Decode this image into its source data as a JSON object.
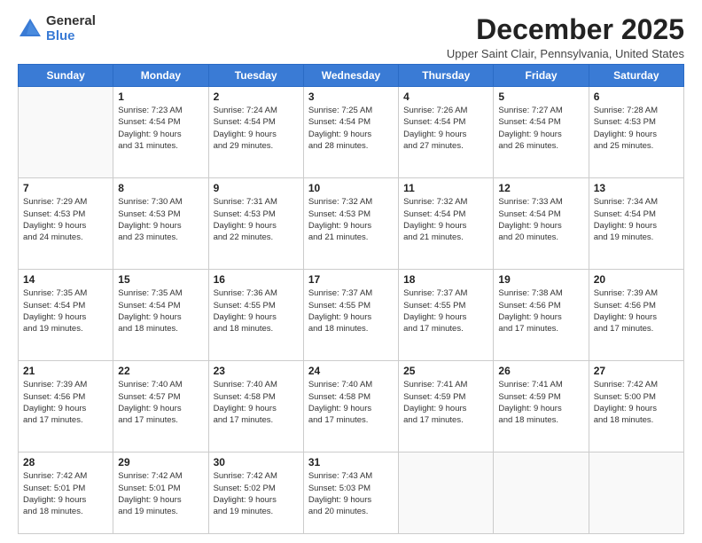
{
  "logo": {
    "general": "General",
    "blue": "Blue"
  },
  "title": "December 2025",
  "location": "Upper Saint Clair, Pennsylvania, United States",
  "days_header": [
    "Sunday",
    "Monday",
    "Tuesday",
    "Wednesday",
    "Thursday",
    "Friday",
    "Saturday"
  ],
  "weeks": [
    [
      {
        "day": "",
        "info": ""
      },
      {
        "day": "1",
        "info": "Sunrise: 7:23 AM\nSunset: 4:54 PM\nDaylight: 9 hours\nand 31 minutes."
      },
      {
        "day": "2",
        "info": "Sunrise: 7:24 AM\nSunset: 4:54 PM\nDaylight: 9 hours\nand 29 minutes."
      },
      {
        "day": "3",
        "info": "Sunrise: 7:25 AM\nSunset: 4:54 PM\nDaylight: 9 hours\nand 28 minutes."
      },
      {
        "day": "4",
        "info": "Sunrise: 7:26 AM\nSunset: 4:54 PM\nDaylight: 9 hours\nand 27 minutes."
      },
      {
        "day": "5",
        "info": "Sunrise: 7:27 AM\nSunset: 4:54 PM\nDaylight: 9 hours\nand 26 minutes."
      },
      {
        "day": "6",
        "info": "Sunrise: 7:28 AM\nSunset: 4:53 PM\nDaylight: 9 hours\nand 25 minutes."
      }
    ],
    [
      {
        "day": "7",
        "info": "Sunrise: 7:29 AM\nSunset: 4:53 PM\nDaylight: 9 hours\nand 24 minutes."
      },
      {
        "day": "8",
        "info": "Sunrise: 7:30 AM\nSunset: 4:53 PM\nDaylight: 9 hours\nand 23 minutes."
      },
      {
        "day": "9",
        "info": "Sunrise: 7:31 AM\nSunset: 4:53 PM\nDaylight: 9 hours\nand 22 minutes."
      },
      {
        "day": "10",
        "info": "Sunrise: 7:32 AM\nSunset: 4:53 PM\nDaylight: 9 hours\nand 21 minutes."
      },
      {
        "day": "11",
        "info": "Sunrise: 7:32 AM\nSunset: 4:54 PM\nDaylight: 9 hours\nand 21 minutes."
      },
      {
        "day": "12",
        "info": "Sunrise: 7:33 AM\nSunset: 4:54 PM\nDaylight: 9 hours\nand 20 minutes."
      },
      {
        "day": "13",
        "info": "Sunrise: 7:34 AM\nSunset: 4:54 PM\nDaylight: 9 hours\nand 19 minutes."
      }
    ],
    [
      {
        "day": "14",
        "info": "Sunrise: 7:35 AM\nSunset: 4:54 PM\nDaylight: 9 hours\nand 19 minutes."
      },
      {
        "day": "15",
        "info": "Sunrise: 7:35 AM\nSunset: 4:54 PM\nDaylight: 9 hours\nand 18 minutes."
      },
      {
        "day": "16",
        "info": "Sunrise: 7:36 AM\nSunset: 4:55 PM\nDaylight: 9 hours\nand 18 minutes."
      },
      {
        "day": "17",
        "info": "Sunrise: 7:37 AM\nSunset: 4:55 PM\nDaylight: 9 hours\nand 18 minutes."
      },
      {
        "day": "18",
        "info": "Sunrise: 7:37 AM\nSunset: 4:55 PM\nDaylight: 9 hours\nand 17 minutes."
      },
      {
        "day": "19",
        "info": "Sunrise: 7:38 AM\nSunset: 4:56 PM\nDaylight: 9 hours\nand 17 minutes."
      },
      {
        "day": "20",
        "info": "Sunrise: 7:39 AM\nSunset: 4:56 PM\nDaylight: 9 hours\nand 17 minutes."
      }
    ],
    [
      {
        "day": "21",
        "info": "Sunrise: 7:39 AM\nSunset: 4:56 PM\nDaylight: 9 hours\nand 17 minutes."
      },
      {
        "day": "22",
        "info": "Sunrise: 7:40 AM\nSunset: 4:57 PM\nDaylight: 9 hours\nand 17 minutes."
      },
      {
        "day": "23",
        "info": "Sunrise: 7:40 AM\nSunset: 4:58 PM\nDaylight: 9 hours\nand 17 minutes."
      },
      {
        "day": "24",
        "info": "Sunrise: 7:40 AM\nSunset: 4:58 PM\nDaylight: 9 hours\nand 17 minutes."
      },
      {
        "day": "25",
        "info": "Sunrise: 7:41 AM\nSunset: 4:59 PM\nDaylight: 9 hours\nand 17 minutes."
      },
      {
        "day": "26",
        "info": "Sunrise: 7:41 AM\nSunset: 4:59 PM\nDaylight: 9 hours\nand 18 minutes."
      },
      {
        "day": "27",
        "info": "Sunrise: 7:42 AM\nSunset: 5:00 PM\nDaylight: 9 hours\nand 18 minutes."
      }
    ],
    [
      {
        "day": "28",
        "info": "Sunrise: 7:42 AM\nSunset: 5:01 PM\nDaylight: 9 hours\nand 18 minutes."
      },
      {
        "day": "29",
        "info": "Sunrise: 7:42 AM\nSunset: 5:01 PM\nDaylight: 9 hours\nand 19 minutes."
      },
      {
        "day": "30",
        "info": "Sunrise: 7:42 AM\nSunset: 5:02 PM\nDaylight: 9 hours\nand 19 minutes."
      },
      {
        "day": "31",
        "info": "Sunrise: 7:43 AM\nSunset: 5:03 PM\nDaylight: 9 hours\nand 20 minutes."
      },
      {
        "day": "",
        "info": ""
      },
      {
        "day": "",
        "info": ""
      },
      {
        "day": "",
        "info": ""
      }
    ]
  ]
}
